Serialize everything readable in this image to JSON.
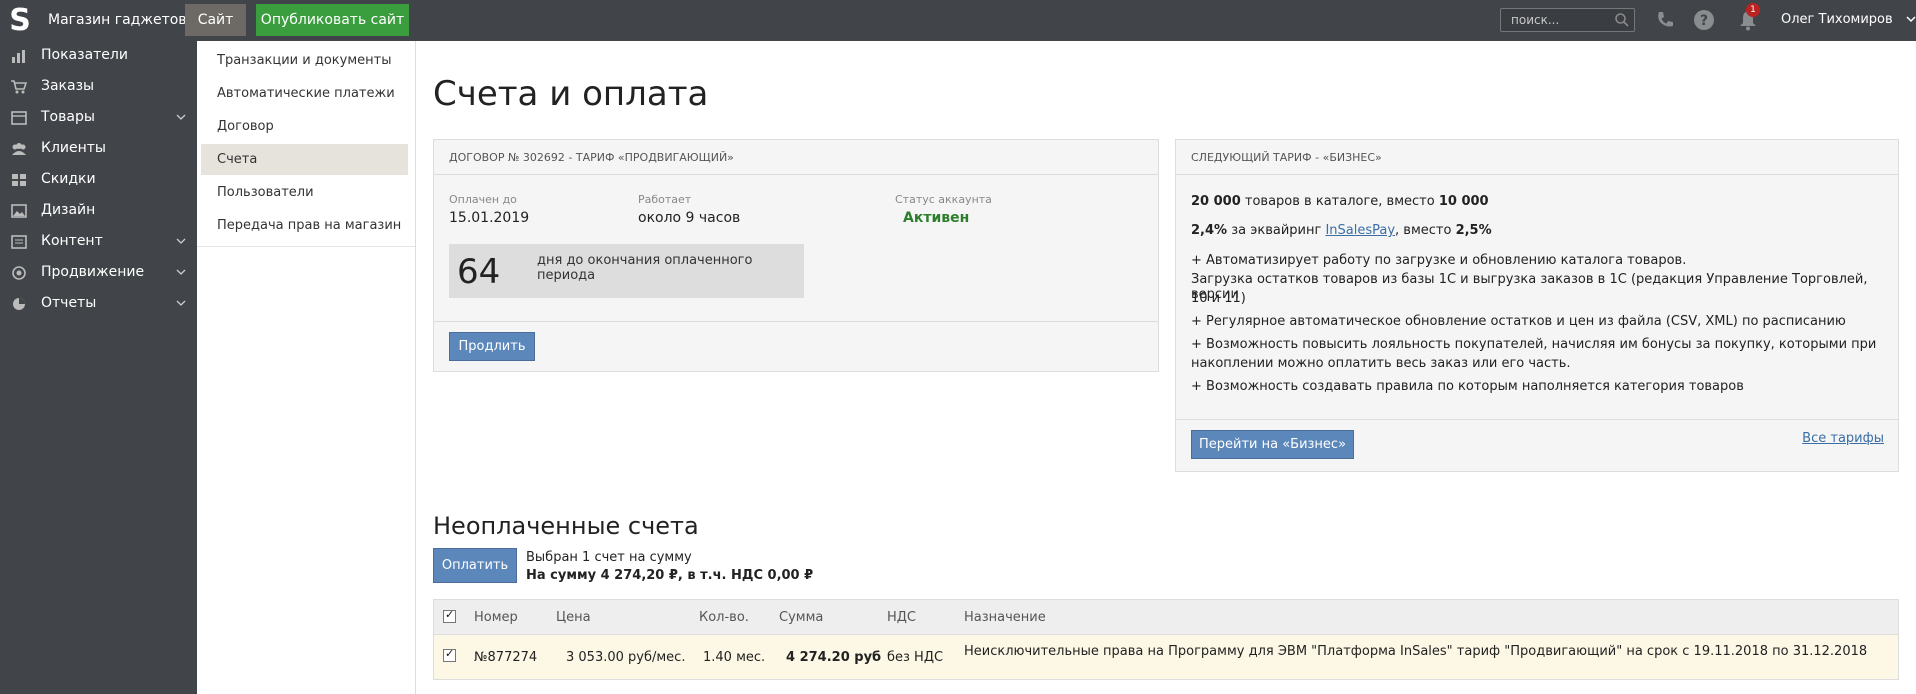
{
  "topbar": {
    "logo": "S",
    "shop_name": "Магазин гаджетов",
    "site_button": "Сайт",
    "publish_button": "Опубликовать сайт",
    "search_placeholder": "поиск...",
    "notifications_count": "1",
    "user_name": "Олег Тихомиров",
    "icons": [
      "phone-icon",
      "help-icon",
      "bell-icon",
      "search-icon"
    ]
  },
  "sidebar": {
    "items": [
      {
        "label": "Показатели",
        "icon": "chart-icon",
        "has_submenu": false
      },
      {
        "label": "Заказы",
        "icon": "cart-icon",
        "has_submenu": false
      },
      {
        "label": "Товары",
        "icon": "box-icon",
        "has_submenu": true
      },
      {
        "label": "Клиенты",
        "icon": "users-icon",
        "has_submenu": false
      },
      {
        "label": "Скидки",
        "icon": "discount-icon",
        "has_submenu": false
      },
      {
        "label": "Дизайн",
        "icon": "image-icon",
        "has_submenu": false
      },
      {
        "label": "Контент",
        "icon": "content-icon",
        "has_submenu": true
      },
      {
        "label": "Продвижение",
        "icon": "promo-icon",
        "has_submenu": true
      },
      {
        "label": "Отчеты",
        "icon": "reports-icon",
        "has_submenu": true
      }
    ]
  },
  "submenu": {
    "items": [
      {
        "label": "Транзакции и документы",
        "active": false
      },
      {
        "label": "Автоматические платежи",
        "active": false
      },
      {
        "label": "Договор",
        "active": false
      },
      {
        "label": "Счета",
        "active": true
      },
      {
        "label": "Пользователи",
        "active": false
      },
      {
        "label": "Передача прав на магазин",
        "active": false
      }
    ]
  },
  "main": {
    "title": "Счета и оплата",
    "contract": {
      "header": "ДОГОВОР № 302692 - ТАРИФ «ПРОДВИГАЮЩИЙ»",
      "paid_until_label": "Оплачен до",
      "paid_until": "15.01.2019",
      "works_label": "Работает",
      "works": "около 9 часов",
      "status_label": "Статус аккаунта",
      "status": "Активен",
      "days_left": "64",
      "days_text": "дня до окончания оплаченного периода",
      "extend_button": "Продлить"
    },
    "next_tariff": {
      "header": "СЛЕДУЮЩИЙ ТАРИФ - «БИЗНЕС»",
      "line1_bold": "20 000",
      "line1_text": " товаров в каталоге, вместо ",
      "line1_bold2": "10 000",
      "line2_bold": "2,4%",
      "line2_text": " за эквайринг ",
      "line2_link": "InSalesPay",
      "line2_text2": ", вместо ",
      "line2_bold2": "2,5%",
      "features": [
        "+ Автоматизирует работу по загрузке и обновлению каталога товаров.",
        "Загрузка остатков товаров из базы 1С и выгрузка заказов в 1С (редакция Управление Торговлей, версии",
        "10 и 11)",
        "+ Регулярное автоматическое обновление остатков и цен из файла (CSV, XML) по расписанию",
        "+ Возможность повысить лояльность покупателей, начисляя им бонусы за покупку, которыми при",
        "накоплении можно оплатить весь заказ или его часть.",
        "+ Возможность создавать правила по которым наполняется категория товаров"
      ],
      "switch_button": "Перейти на «Бизнес»",
      "all_tariffs_link": "Все тарифы"
    },
    "unpaid": {
      "title": "Неоплаченные счета",
      "pay_button": "Оплатить",
      "selected_text": "Выбран 1 счет на сумму",
      "selected_sum": "На сумму 4 274,20 ₽, в т.ч. НДС 0,00 ₽",
      "columns": [
        "Номер",
        "Цена",
        "Кол-во.",
        "Сумма",
        "НДС",
        "Назначение"
      ],
      "rows": [
        {
          "number": "№877274",
          "price": "3 053.00 руб/мес.",
          "qty": "1.40 мес.",
          "sum": "4 274.20 руб",
          "vat": "без НДС",
          "purpose": "Неисключительные права на Программу для ЭВМ \"Платформа InSales\" тариф \"Продвигающий\" на срок с 19.11.2018 по 31.12.2018",
          "checked": true
        }
      ]
    }
  }
}
